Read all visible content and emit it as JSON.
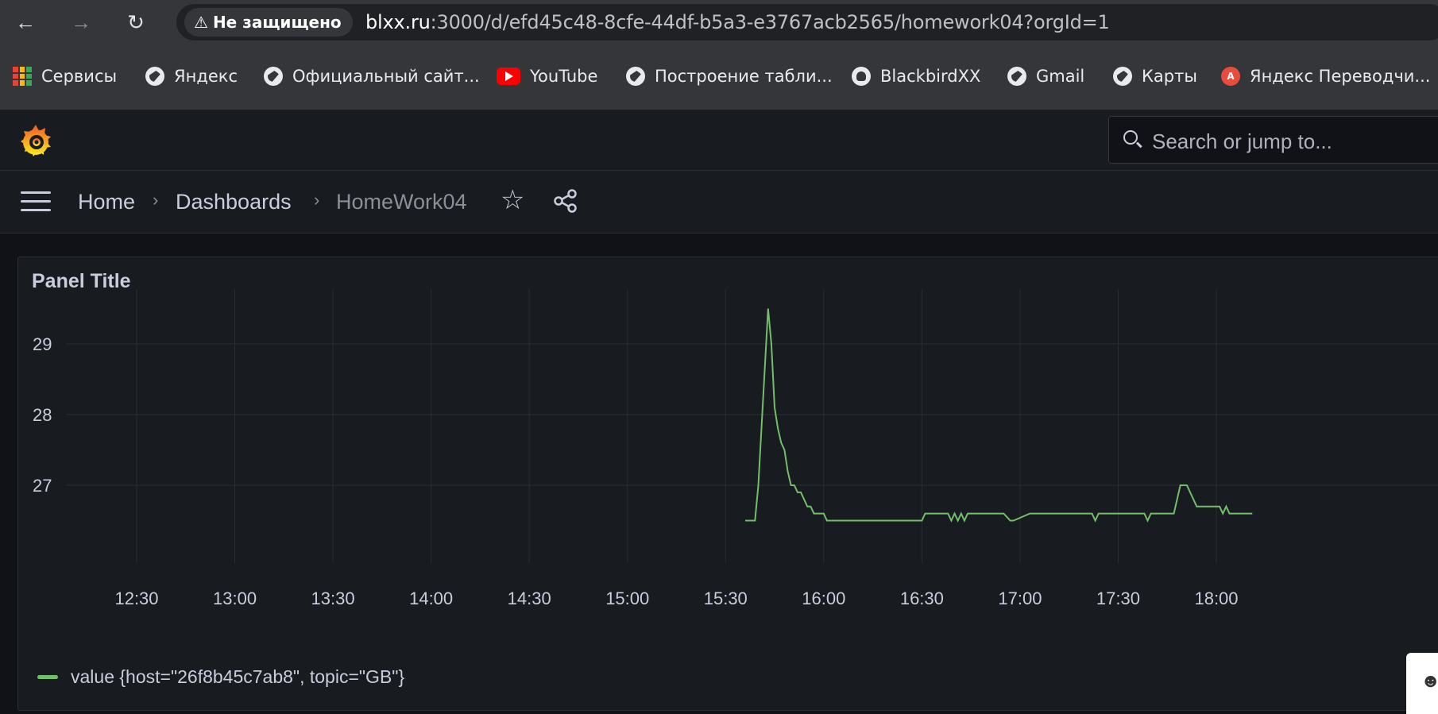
{
  "browser": {
    "security_label": "Не защищено",
    "url_host": "blxx.ru",
    "url_path": ":3000/d/efd45c48-8cfe-44df-b5a3-e3767acb2565/homework04?orgId=1",
    "bookmarks": [
      {
        "label": "Сервисы",
        "icon": "apps-grid-icon"
      },
      {
        "label": "Яндекс",
        "icon": "globe-icon"
      },
      {
        "label": "Официальный сайт...",
        "icon": "globe-icon"
      },
      {
        "label": "YouTube",
        "icon": "youtube-icon"
      },
      {
        "label": "Построение табли...",
        "icon": "globe-icon"
      },
      {
        "label": "BlackbirdXX",
        "icon": "github-icon"
      },
      {
        "label": "Gmail",
        "icon": "globe-icon"
      },
      {
        "label": "Карты",
        "icon": "globe-icon"
      },
      {
        "label": "Яндекс Переводчи...",
        "icon": "translate-icon"
      }
    ]
  },
  "grafana": {
    "search_placeholder": "Search or jump to...",
    "breadcrumb": [
      "Home",
      "Dashboards",
      "HomeWork04"
    ],
    "panel_title": "Panel Title",
    "legend_label": "value {host=\"26f8b45c7ab8\", topic=\"GB\"}"
  },
  "colors": {
    "series": "#73bf69",
    "background": "#111217",
    "panel": "#181b1f"
  },
  "chart_data": {
    "type": "line",
    "title": "Panel Title",
    "x_ticks": [
      "12:30",
      "13:00",
      "13:30",
      "14:00",
      "14:30",
      "15:00",
      "15:30",
      "16:00",
      "16:30",
      "17:00",
      "17:30",
      "18:00"
    ],
    "y_ticks": [
      27,
      28,
      29
    ],
    "ylim": [
      26.2,
      29.8
    ],
    "grid": true,
    "legend_position": "bottom-left",
    "series": [
      {
        "name": "value {host=\"26f8b45c7ab8\", topic=\"GB\"}",
        "points": [
          [
            "15:36",
            26.5
          ],
          [
            "15:39",
            26.5
          ],
          [
            "15:40",
            27.0
          ],
          [
            "15:43",
            29.5
          ],
          [
            "15:44",
            29.0
          ],
          [
            "15:45",
            28.1
          ],
          [
            "15:46",
            27.8
          ],
          [
            "15:47",
            27.6
          ],
          [
            "15:48",
            27.5
          ],
          [
            "15:49",
            27.2
          ],
          [
            "15:50",
            27.0
          ],
          [
            "15:51",
            27.0
          ],
          [
            "15:52",
            26.9
          ],
          [
            "15:53",
            26.9
          ],
          [
            "15:54",
            26.8
          ],
          [
            "15:55",
            26.7
          ],
          [
            "15:56",
            26.7
          ],
          [
            "15:57",
            26.6
          ],
          [
            "16:00",
            26.6
          ],
          [
            "16:01",
            26.5
          ],
          [
            "16:30",
            26.5
          ],
          [
            "16:31",
            26.6
          ],
          [
            "16:38",
            26.6
          ],
          [
            "16:39",
            26.5
          ],
          [
            "16:40",
            26.6
          ],
          [
            "16:41",
            26.5
          ],
          [
            "16:42",
            26.6
          ],
          [
            "16:43",
            26.5
          ],
          [
            "16:44",
            26.6
          ],
          [
            "16:55",
            26.6
          ],
          [
            "16:57",
            26.5
          ],
          [
            "16:58",
            26.5
          ],
          [
            "17:03",
            26.6
          ],
          [
            "17:22",
            26.6
          ],
          [
            "17:23",
            26.5
          ],
          [
            "17:24",
            26.6
          ],
          [
            "17:38",
            26.6
          ],
          [
            "17:39",
            26.5
          ],
          [
            "17:40",
            26.6
          ],
          [
            "17:41",
            26.6
          ],
          [
            "17:42",
            26.6
          ],
          [
            "17:43",
            26.6
          ],
          [
            "17:47",
            26.6
          ],
          [
            "17:49",
            27.0
          ],
          [
            "17:51",
            27.0
          ],
          [
            "17:53",
            26.8
          ],
          [
            "17:54",
            26.7
          ],
          [
            "18:01",
            26.7
          ],
          [
            "18:02",
            26.6
          ],
          [
            "18:03",
            26.7
          ],
          [
            "18:04",
            26.6
          ],
          [
            "18:11",
            26.6
          ]
        ]
      }
    ]
  }
}
